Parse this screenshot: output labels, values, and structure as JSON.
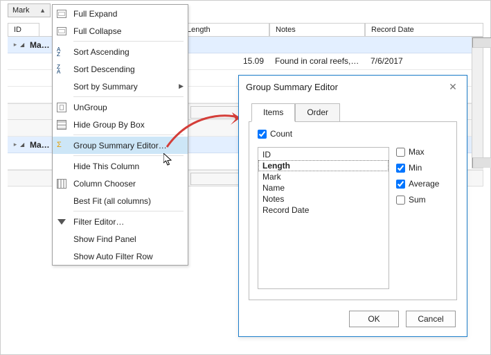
{
  "group_by": {
    "field": "Mark",
    "sort_glyph": "▲"
  },
  "columns": {
    "id": "ID",
    "length": "Length",
    "notes": "Notes",
    "recdate": "Record Date"
  },
  "grid": {
    "group1_caret": "◢",
    "group1_label": "Ma…",
    "row1": {
      "length": "15.09",
      "notes": "Found in coral reefs, r…",
      "recdate": "7/6/2017"
    },
    "group2_caret": "◢",
    "group2_label": "Ma…"
  },
  "menu": {
    "full_expand": "Full Expand",
    "full_collapse": "Full Collapse",
    "sort_asc": "Sort Ascending",
    "sort_desc": "Sort Descending",
    "sort_by_summary": "Sort by Summary",
    "ungroup": "UnGroup",
    "hide_gbb": "Hide Group By Box",
    "gse": "Group Summary Editor…",
    "hide_col": "Hide This Column",
    "col_chooser": "Column Chooser",
    "best_fit": "Best Fit (all columns)",
    "filter_editor": "Filter Editor…",
    "show_find": "Show Find Panel",
    "show_autofilter": "Show Auto Filter Row"
  },
  "dialog": {
    "title": "Group Summary Editor",
    "tab_items": "Items",
    "tab_order": "Order",
    "count": "Count",
    "fields": [
      "ID",
      "Length",
      "Mark",
      "Name",
      "Notes",
      "Record Date"
    ],
    "selected_field_index": 1,
    "agg": {
      "max": "Max",
      "min": "Min",
      "avg": "Average",
      "sum": "Sum"
    },
    "agg_state": {
      "max": false,
      "min": true,
      "avg": true,
      "sum": false
    },
    "count_state": true,
    "ok": "OK",
    "cancel": "Cancel"
  }
}
